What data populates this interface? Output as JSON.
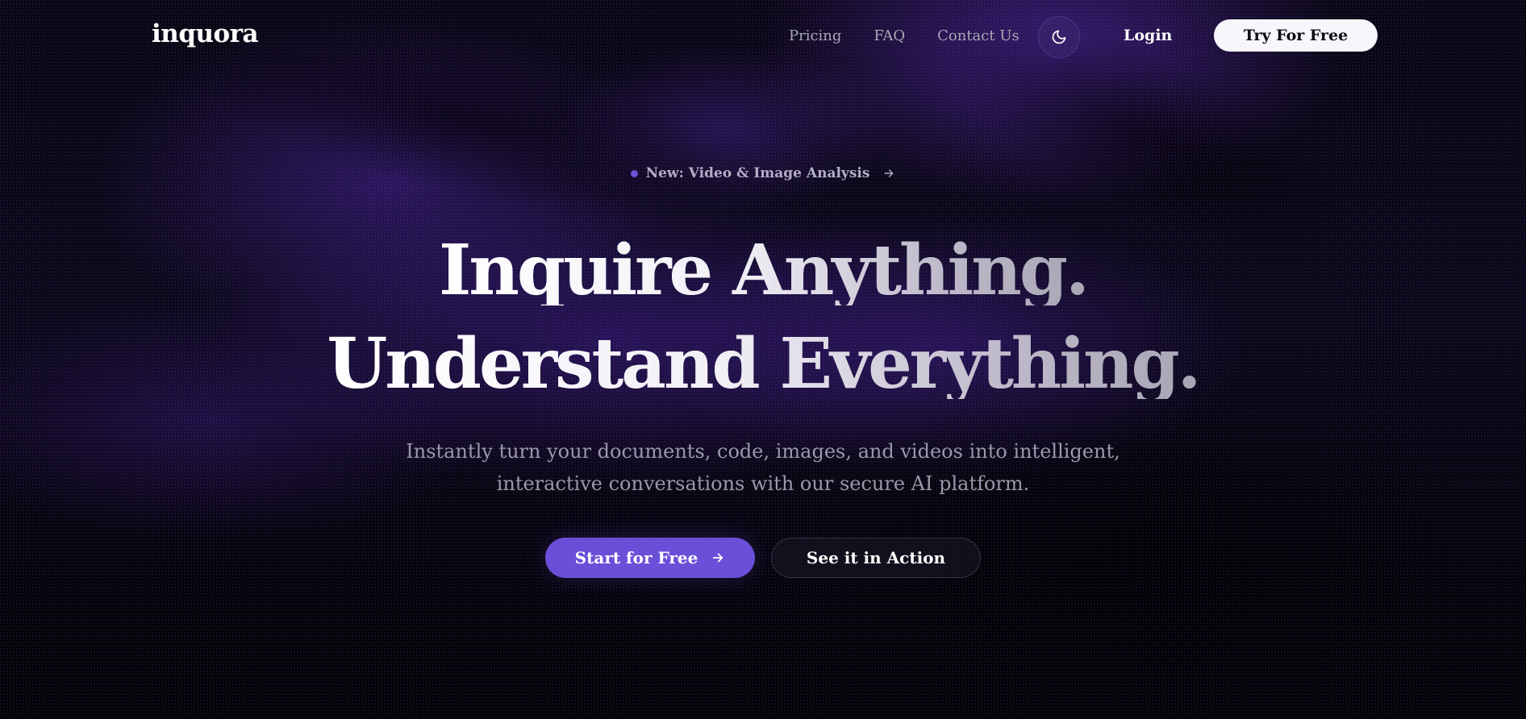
{
  "brand": {
    "logo_text": "inquora"
  },
  "nav": {
    "links": [
      {
        "label": "Pricing"
      },
      {
        "label": "FAQ"
      },
      {
        "label": "Contact Us"
      }
    ],
    "theme_toggle_icon": "moon-icon",
    "login_label": "Login",
    "try_label": "Try For Free"
  },
  "hero": {
    "badge_text": "New: Video & Image Analysis",
    "badge_icon": "arrow-right-icon",
    "headline_line1": "Inquire Anything.",
    "headline_line2": "Understand Everything.",
    "subtitle_line1": "Instantly turn your documents, code, images, and videos into intelligent,",
    "subtitle_line2": "interactive conversations with our secure AI platform.",
    "primary_cta": "Start for Free",
    "primary_cta_icon": "arrow-right-icon",
    "secondary_cta": "See it in Action"
  },
  "colors": {
    "accent": "#6a4fd8",
    "background": "#050408",
    "text_primary": "#ffffff",
    "text_muted": "#9c98aa"
  }
}
